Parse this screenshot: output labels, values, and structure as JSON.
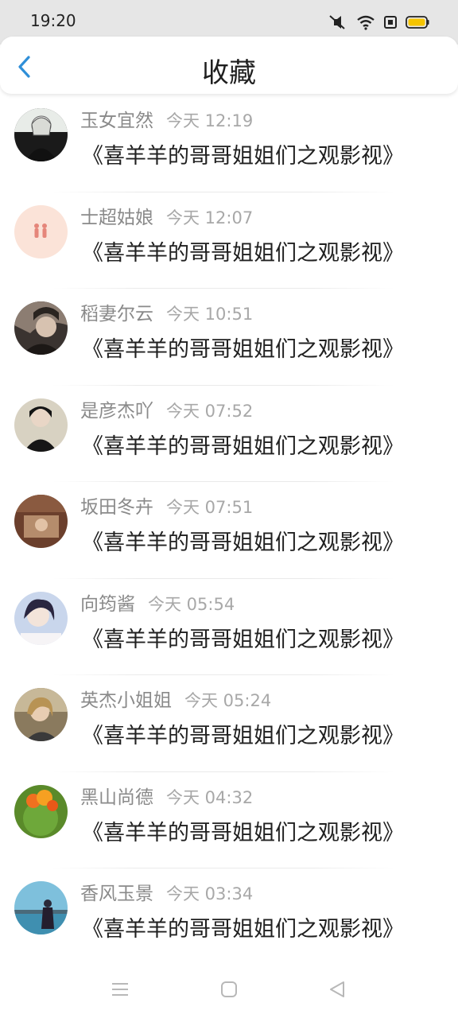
{
  "status_bar": {
    "time": "19:20",
    "icons": [
      "mute-icon",
      "wifi-icon",
      "sim-icon",
      "battery-icon"
    ],
    "battery_color": "#f5c400"
  },
  "header": {
    "title": "收藏",
    "back_icon": "chevron-left-icon",
    "accent_color": "#2f8fd8"
  },
  "favorites": [
    {
      "name": "玉女宜然",
      "time": "今天 12:19",
      "text": "《喜羊羊的哥哥姐姐们之观影视》",
      "avatar_bg": "#1a1a1a"
    },
    {
      "name": "士超姑娘",
      "time": "今天 12:07",
      "text": "《喜羊羊的哥哥姐姐们之观影视》",
      "avatar_bg": "#fbe3d8"
    },
    {
      "name": "稻妻尔云",
      "time": "今天 10:51",
      "text": "《喜羊羊的哥哥姐姐们之观影视》",
      "avatar_bg": "#3a3330"
    },
    {
      "name": "是彦杰吖",
      "time": "今天 07:52",
      "text": "《喜羊羊的哥哥姐姐们之观影视》",
      "avatar_bg": "#d8d2c2"
    },
    {
      "name": "坂田冬卉",
      "time": "今天 07:51",
      "text": "《喜羊羊的哥哥姐姐们之观影视》",
      "avatar_bg": "#6b3f2c"
    },
    {
      "name": "向筠酱",
      "time": "今天 05:54",
      "text": "《喜羊羊的哥哥姐姐们之观影视》",
      "avatar_bg": "#c9d6ec"
    },
    {
      "name": "英杰小姐姐",
      "time": "今天 05:24",
      "text": "《喜羊羊的哥哥姐姐们之观影视》",
      "avatar_bg": "#8a7a5e"
    },
    {
      "name": "黑山尚德",
      "time": "今天 04:32",
      "text": "《喜羊羊的哥哥姐姐们之观影视》",
      "avatar_bg": "#5a8a2a"
    },
    {
      "name": "香风玉景",
      "time": "今天 03:34",
      "text": "《喜羊羊的哥哥姐姐们之观影视》",
      "avatar_bg": "#3f8fb0"
    }
  ],
  "nav_bar": {
    "buttons": [
      "menu-icon",
      "home-icon",
      "back-triangle-icon"
    ]
  }
}
